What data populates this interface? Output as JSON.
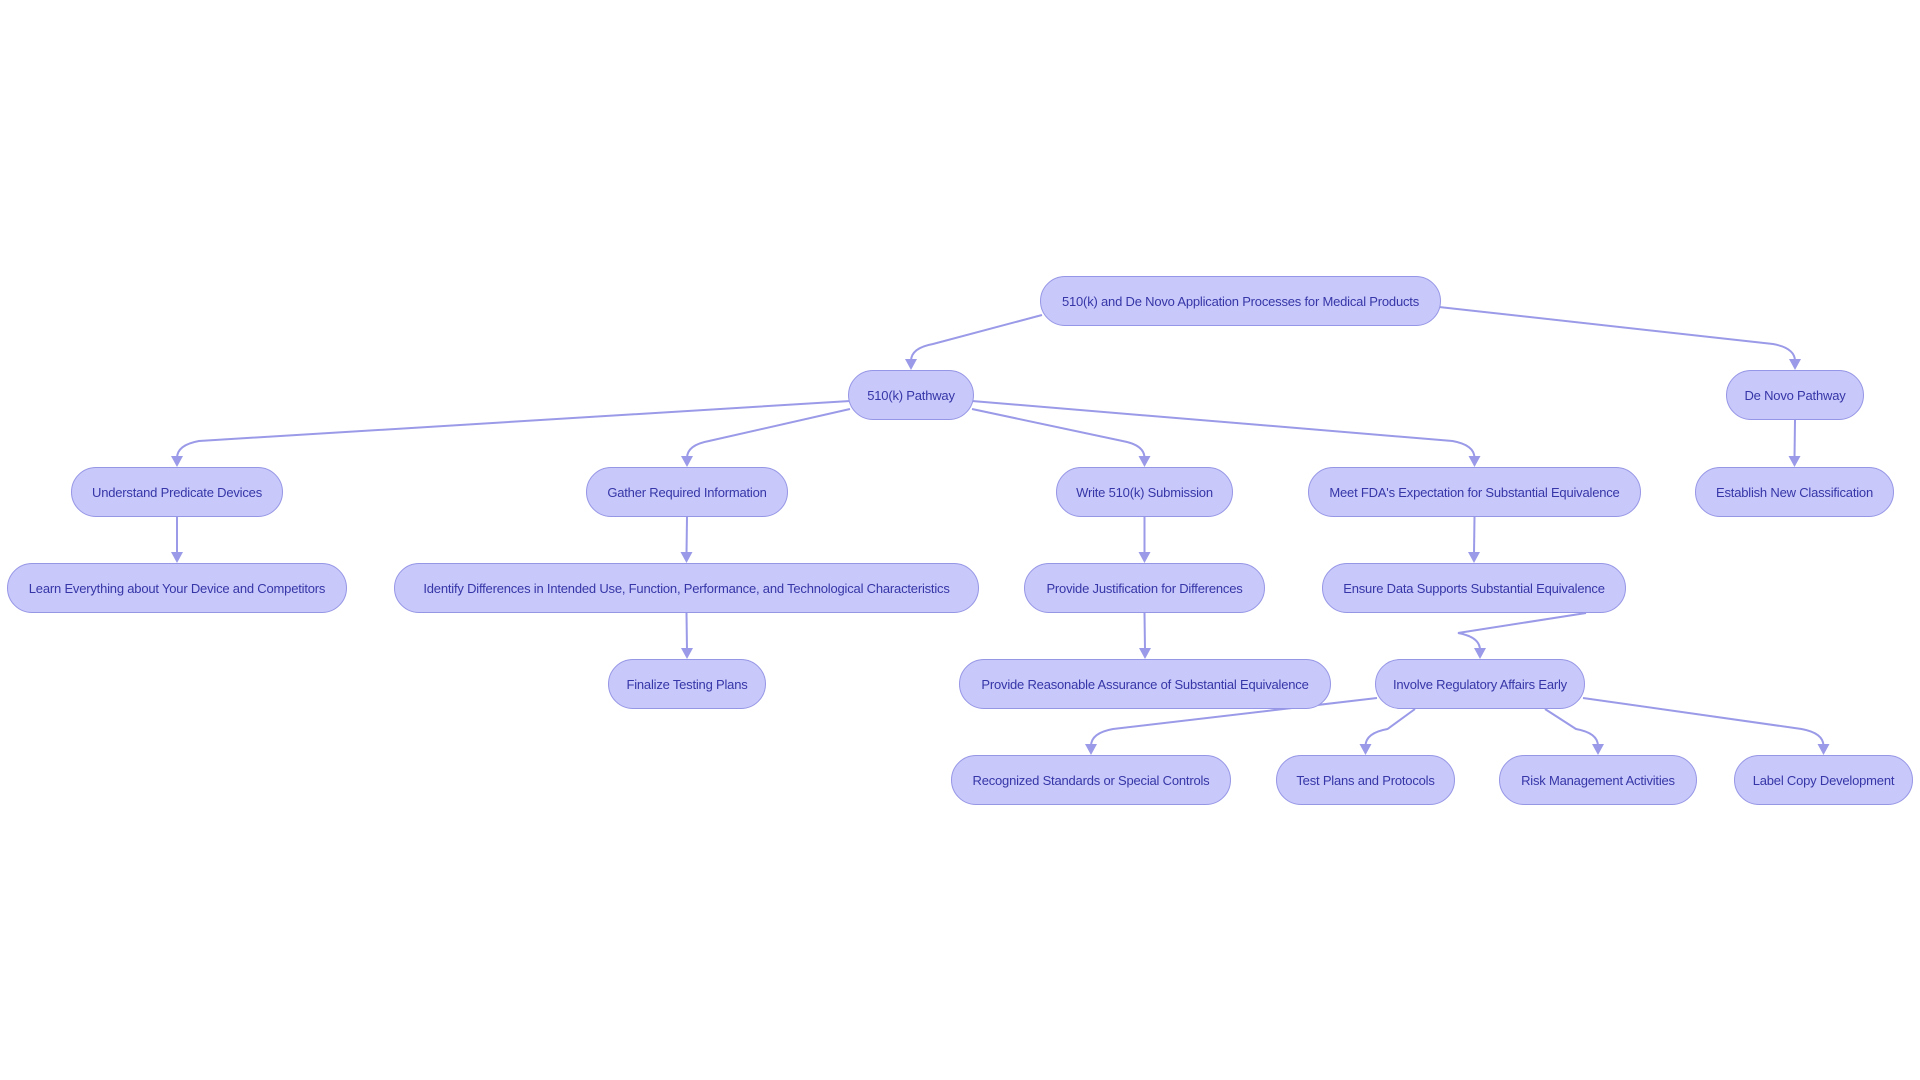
{
  "diagram": {
    "type": "flowchart-tree",
    "colors": {
      "node_fill": "#c8c8fa",
      "node_border": "#9696e6",
      "node_text": "#3636a8",
      "edge": "#9a9ae8"
    },
    "nodes": [
      {
        "id": "root",
        "label": "510(k) and De Novo Application Processes for Medical Products"
      },
      {
        "id": "k510",
        "label": "510(k) Pathway"
      },
      {
        "id": "denovo",
        "label": "De Novo Pathway"
      },
      {
        "id": "understand",
        "label": "Understand Predicate Devices"
      },
      {
        "id": "gather",
        "label": "Gather Required Information"
      },
      {
        "id": "write",
        "label": "Write 510(k) Submission"
      },
      {
        "id": "meet",
        "label": "Meet FDA's Expectation for Substantial Equivalence"
      },
      {
        "id": "establish",
        "label": "Establish New Classification"
      },
      {
        "id": "learn",
        "label": "Learn Everything about Your Device and Competitors"
      },
      {
        "id": "identify",
        "label": "Identify Differences in Intended Use, Function, Performance, and Technological Characteristics"
      },
      {
        "id": "justify",
        "label": "Provide Justification for Differences"
      },
      {
        "id": "ensure",
        "label": "Ensure Data Supports Substantial Equivalence"
      },
      {
        "id": "finalize",
        "label": "Finalize Testing Plans"
      },
      {
        "id": "assurance",
        "label": "Provide Reasonable Assurance of Substantial Equivalence"
      },
      {
        "id": "involve",
        "label": "Involve Regulatory Affairs Early"
      },
      {
        "id": "standards",
        "label": "Recognized Standards or Special Controls"
      },
      {
        "id": "testplans",
        "label": "Test Plans and Protocols"
      },
      {
        "id": "risk",
        "label": "Risk Management Activities"
      },
      {
        "id": "labelcopy",
        "label": "Label Copy Development"
      }
    ],
    "edges": [
      {
        "from": "root",
        "to": "k510"
      },
      {
        "from": "root",
        "to": "denovo"
      },
      {
        "from": "k510",
        "to": "understand"
      },
      {
        "from": "k510",
        "to": "gather"
      },
      {
        "from": "k510",
        "to": "write"
      },
      {
        "from": "k510",
        "to": "meet"
      },
      {
        "from": "denovo",
        "to": "establish"
      },
      {
        "from": "understand",
        "to": "learn"
      },
      {
        "from": "gather",
        "to": "identify"
      },
      {
        "from": "write",
        "to": "justify"
      },
      {
        "from": "meet",
        "to": "ensure"
      },
      {
        "from": "identify",
        "to": "finalize"
      },
      {
        "from": "justify",
        "to": "assurance"
      },
      {
        "from": "ensure",
        "to": "involve"
      },
      {
        "from": "involve",
        "to": "standards"
      },
      {
        "from": "involve",
        "to": "testplans"
      },
      {
        "from": "involve",
        "to": "risk"
      },
      {
        "from": "involve",
        "to": "labelcopy"
      }
    ]
  }
}
